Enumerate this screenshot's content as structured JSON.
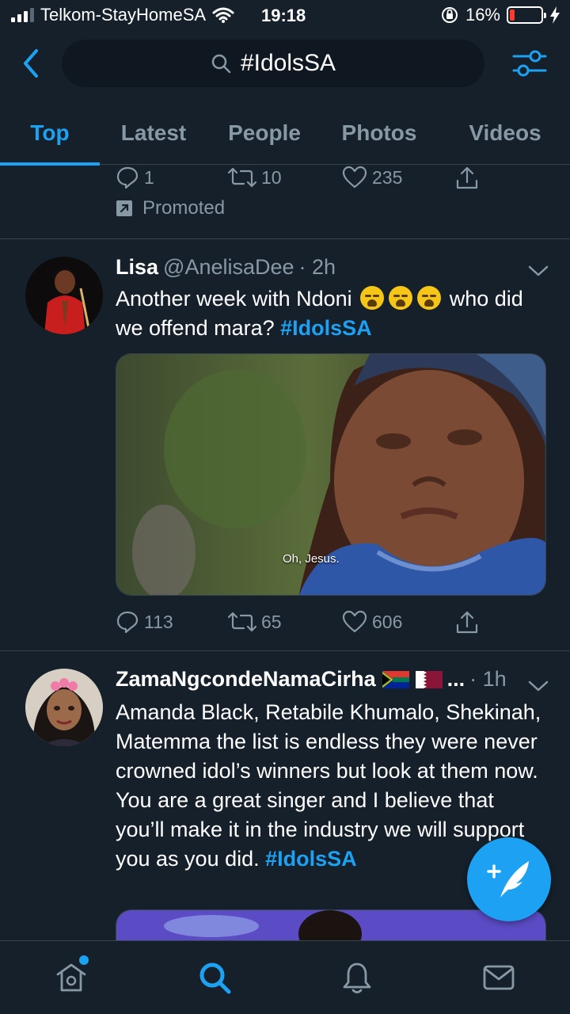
{
  "status_bar": {
    "carrier": "Telkom-StayHomeSA",
    "time": "19:18",
    "battery_percent": "16%",
    "battery_level": 0.16,
    "battery_color": "#ff3b30"
  },
  "header": {
    "search_query": "#IdolsSA",
    "back_icon": "chevron-left-icon",
    "filter_icon": "sliders-icon"
  },
  "tabs": [
    {
      "label": "Top",
      "active": true
    },
    {
      "label": "Latest",
      "active": false
    },
    {
      "label": "People",
      "active": false
    },
    {
      "label": "Photos",
      "active": false
    },
    {
      "label": "Videos",
      "active": false
    }
  ],
  "colors": {
    "background": "#15202b",
    "accent": "#1da1f2",
    "secondary_text": "#8899a6",
    "divider": "#38444d"
  },
  "promoted_tweet": {
    "replies": "1",
    "retweets": "10",
    "likes": "235",
    "promoted_label": "Promoted"
  },
  "tweets": [
    {
      "name": "Lisa",
      "handle": "@AnelisaDee",
      "time": "· 2h",
      "text_part1": "Another week with Ndoni",
      "text_part2": "who did we offend mara?",
      "hashtag": "#IdolsSA",
      "media_caption": "Oh, Jesus.",
      "replies": "113",
      "retweets": "65",
      "likes": "606"
    },
    {
      "name": "ZamaNgcondeNamaCirha",
      "name_suffix": "...",
      "time": "· 1h",
      "text": "Amanda Black, Retabile Khumalo, Shekinah, Matemma the list is endless they were never crowned idol’s winners but look at them now. You are a great singer and I believe that you’ll make it in the industry we will support you as you did.",
      "hashtag": "#IdolsSA"
    }
  ],
  "bottom_nav": [
    {
      "icon": "home-icon",
      "active": false,
      "has_dot": true
    },
    {
      "icon": "search-icon",
      "active": true
    },
    {
      "icon": "bell-icon",
      "active": false
    },
    {
      "icon": "mail-icon",
      "active": false
    }
  ],
  "fab": {
    "icon": "compose-tweet-icon"
  }
}
